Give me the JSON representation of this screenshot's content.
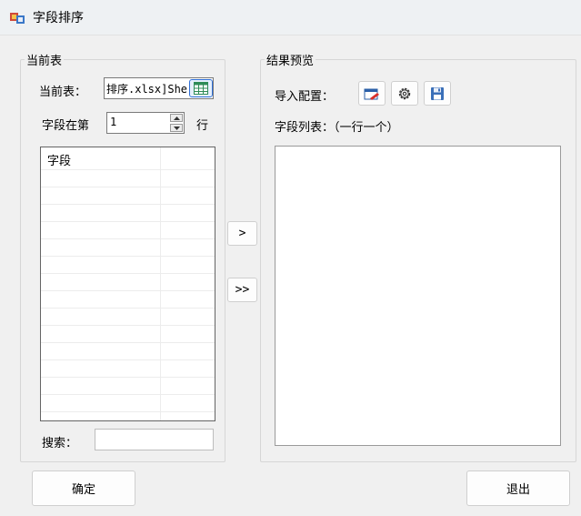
{
  "window": {
    "title": "字段排序"
  },
  "left_panel": {
    "legend": "当前表",
    "current_table_label": "当前表：",
    "current_table_value": "排序.xlsx]She",
    "field_row_label": "字段在第",
    "field_row_value": "1",
    "row_suffix": "行",
    "grid": {
      "header": "字段",
      "rows": [
        "",
        "",
        "",
        "",
        "",
        "",
        "",
        "",
        "",
        "",
        "",
        "",
        "",
        "",
        ""
      ]
    },
    "search_label": "搜索：",
    "search_value": ""
  },
  "middle": {
    "move_one_label": ">",
    "move_all_label": ">>"
  },
  "right_panel": {
    "legend": "结果预览",
    "import_config_label": "导入配置：",
    "field_list_label": "字段列表：（一行一个）",
    "field_list_value": ""
  },
  "footer": {
    "ok_label": "确定",
    "exit_label": "退出"
  }
}
